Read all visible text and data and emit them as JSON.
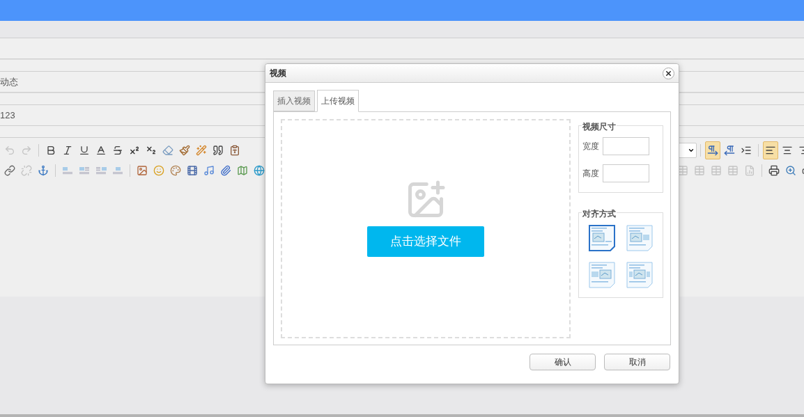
{
  "fields": [
    {
      "value": "动态"
    },
    {
      "value": "123"
    }
  ],
  "toolbar": {
    "row_1_left": [
      [
        {
          "kind": "undo",
          "disabled": true
        },
        {
          "kind": "redo",
          "disabled": true
        }
      ],
      [
        {
          "kind": "bold",
          "disabled": false
        },
        {
          "kind": "italic",
          "disabled": false
        },
        {
          "kind": "underline",
          "disabled": false
        },
        {
          "kind": "font-border",
          "disabled": false
        },
        {
          "kind": "strike",
          "disabled": false
        },
        {
          "kind": "sup",
          "disabled": false
        },
        {
          "kind": "sub",
          "disabled": false
        },
        {
          "kind": "eraser",
          "disabled": false
        },
        {
          "kind": "brush",
          "disabled": false
        },
        {
          "kind": "wand",
          "disabled": false
        },
        {
          "kind": "quote",
          "disabled": false
        },
        {
          "kind": "paste",
          "disabled": false
        }
      ]
    ],
    "row_2_left": [
      [
        {
          "kind": "link",
          "disabled": false
        },
        {
          "kind": "unlink",
          "disabled": true
        },
        {
          "kind": "anchor",
          "disabled": false
        }
      ],
      [
        {
          "kind": "img-none",
          "disabled": false
        },
        {
          "kind": "img-left",
          "disabled": false
        },
        {
          "kind": "img-right",
          "disabled": false
        },
        {
          "kind": "img-center",
          "disabled": false
        }
      ],
      [
        {
          "kind": "image",
          "disabled": false
        },
        {
          "kind": "emoji",
          "disabled": false
        },
        {
          "kind": "palette",
          "disabled": false
        },
        {
          "kind": "film",
          "disabled": false
        },
        {
          "kind": "music",
          "disabled": false
        },
        {
          "kind": "attach",
          "disabled": false
        },
        {
          "kind": "map",
          "disabled": false
        },
        {
          "kind": "globe",
          "disabled": false
        }
      ]
    ],
    "row_1_right": [
      [
        {
          "kind": "ltr",
          "selected": true
        },
        {
          "kind": "rtl",
          "selected": false
        },
        {
          "kind": "indent",
          "selected": false
        }
      ],
      [
        {
          "kind": "align-left",
          "selected": true
        },
        {
          "kind": "align-center",
          "selected": false
        },
        {
          "kind": "align-right",
          "selected": false
        }
      ]
    ],
    "row_2_right": [
      [
        {
          "kind": "table",
          "disabled": true
        },
        {
          "kind": "table",
          "disabled": true
        },
        {
          "kind": "table",
          "disabled": true
        },
        {
          "kind": "table",
          "disabled": true
        },
        {
          "kind": "chart",
          "disabled": true
        }
      ],
      [
        {
          "kind": "print",
          "disabled": false
        },
        {
          "kind": "preview",
          "disabled": false
        },
        {
          "kind": "more",
          "disabled": false
        }
      ]
    ]
  },
  "dialog": {
    "title": "视频",
    "tabs": [
      {
        "label": "插入视频",
        "selected": false
      },
      {
        "label": "上传视频",
        "selected": true
      }
    ],
    "upload": {
      "button": "点击选择文件"
    },
    "size": {
      "legend": "视频尺寸",
      "fields": [
        {
          "label": "宽度"
        },
        {
          "label": "高度"
        }
      ]
    },
    "align": {
      "legend": "对齐方式",
      "options": [
        {
          "kind": "none",
          "selected": true
        },
        {
          "kind": "left",
          "selected": false
        },
        {
          "kind": "right",
          "selected": false
        },
        {
          "kind": "center",
          "selected": false
        }
      ]
    },
    "buttons": [
      "确认",
      "取消"
    ]
  }
}
